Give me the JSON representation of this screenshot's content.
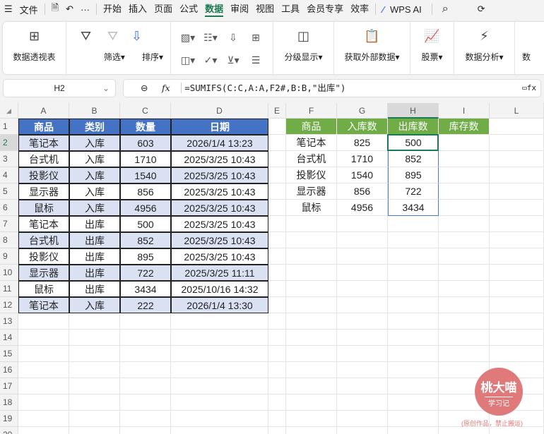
{
  "menu": {
    "file": "文件",
    "more": "···",
    "tabs": [
      "开始",
      "插入",
      "页面",
      "公式",
      "数据",
      "审阅",
      "视图",
      "工具",
      "会员专享",
      "效率"
    ],
    "active_tab": "数据",
    "wps_ai": "WPS AI"
  },
  "ribbon": {
    "pivot": "数据透视表",
    "filter": "筛选",
    "sort": "排序",
    "outline": "分级显示",
    "external": "获取外部数据",
    "stock": "股票",
    "analysis": "数据分析",
    "more": "数"
  },
  "formula_bar": {
    "name_box": "H2",
    "fx": "fx",
    "formula": "=SUMIFS(C:C,A:A,F2#,B:B,\"出库\")"
  },
  "columns": [
    "A",
    "B",
    "C",
    "D",
    "E",
    "F",
    "G",
    "H",
    "I",
    "L"
  ],
  "rows": [
    "1",
    "2",
    "3",
    "4",
    "5",
    "6",
    "7",
    "8",
    "9",
    "10",
    "11",
    "12",
    "13",
    "14",
    "15",
    "16",
    "17",
    "18",
    "19",
    "20"
  ],
  "table1": {
    "headers": [
      "商品",
      "类别",
      "数量",
      "日期"
    ],
    "rows": [
      [
        "笔记本",
        "入库",
        "603",
        "2026/1/4 13:23"
      ],
      [
        "台式机",
        "入库",
        "1710",
        "2025/3/25 10:43"
      ],
      [
        "投影仪",
        "入库",
        "1540",
        "2025/3/25 10:43"
      ],
      [
        "显示器",
        "入库",
        "856",
        "2025/3/25 10:43"
      ],
      [
        "鼠标",
        "入库",
        "4956",
        "2025/3/25 10:43"
      ],
      [
        "笔记本",
        "出库",
        "500",
        "2025/3/25 10:43"
      ],
      [
        "台式机",
        "出库",
        "852",
        "2025/3/25 10:43"
      ],
      [
        "投影仪",
        "出库",
        "895",
        "2025/3/25 10:43"
      ],
      [
        "显示器",
        "出库",
        "722",
        "2025/3/25 11:11"
      ],
      [
        "鼠标",
        "出库",
        "3434",
        "2025/10/16 14:32"
      ],
      [
        "笔记本",
        "入库",
        "222",
        "2026/1/4 13:30"
      ]
    ]
  },
  "table2": {
    "headers": [
      "商品",
      "入库数",
      "出库数",
      "库存数"
    ],
    "rows": [
      [
        "笔记本",
        "825",
        "500"
      ],
      [
        "台式机",
        "1710",
        "852"
      ],
      [
        "投影仪",
        "1540",
        "895"
      ],
      [
        "显示器",
        "856",
        "722"
      ],
      [
        "鼠标",
        "4956",
        "3434"
      ]
    ]
  },
  "colors": {
    "blue_header": "#4472c4",
    "blue_fill": "#d9e1f2",
    "green_header": "#70ad47",
    "accent": "#1a7a52"
  },
  "watermark": {
    "title": "桃大喵",
    "sub": "学习记",
    "note": "(原创作品，禁止搬运)"
  }
}
